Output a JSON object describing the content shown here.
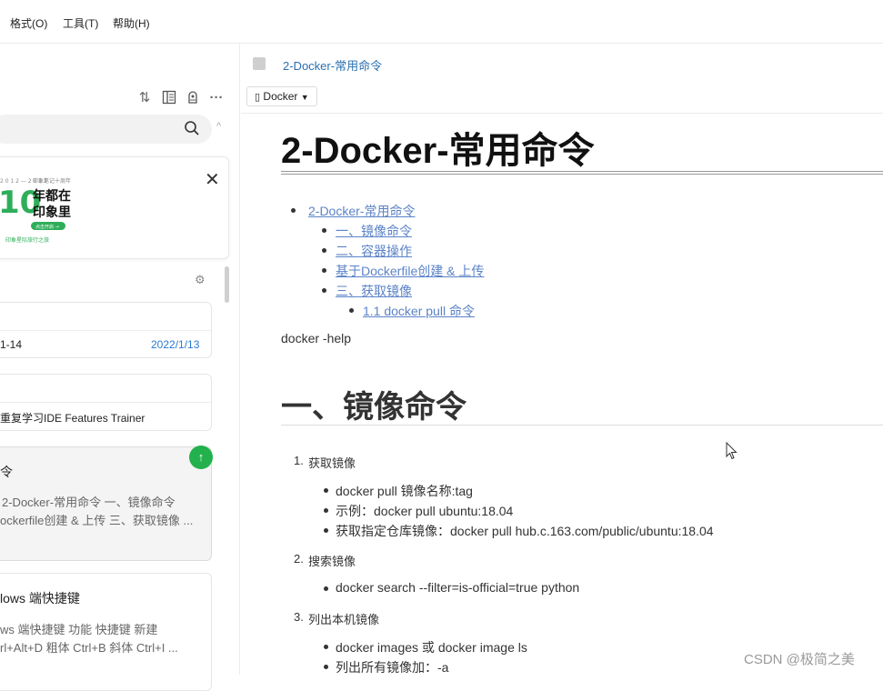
{
  "menu": {
    "format": "格式(O)",
    "tools": "工具(T)",
    "help": "帮助(H)"
  },
  "sidebar": {
    "cards": [
      {
        "date_partial": "1-14",
        "date": "2022/1/13"
      },
      {
        "snippet": "重复学习IDE Features Trainer"
      },
      {
        "title_partial": "令",
        "snippet_line1": "2-Docker-常用命令 一、镜像命令",
        "snippet_line2": "ockerfile创建 & 上传 三、获取镜像 ..."
      },
      {
        "title_partial": "lows 端快捷键",
        "snippet_line1": "ws 端快捷键 功能 快捷键 新建",
        "snippet_line2": "rl+Alt+D 粗体 Ctrl+B 斜体 Ctrl+I ..."
      }
    ],
    "promo_alt": "印象笔记十周年 年都在印象里",
    "sync_symbol": "↑"
  },
  "header": {
    "breadcrumb": "2-Docker-常用命令",
    "notebook": "Docker"
  },
  "doc": {
    "title": "2-Docker-常用命令",
    "toc": [
      {
        "label": "2-Docker-常用命令",
        "level": 1
      },
      {
        "label": "一、镜像命令",
        "level": 2
      },
      {
        "label": "二、容器操作",
        "level": 2
      },
      {
        "label": "基于Dockerfile创建 & 上传",
        "level": 2
      },
      {
        "label": "三、获取镜像",
        "level": 2
      },
      {
        "label": "1.1 docker pull 命令",
        "level": 3
      }
    ],
    "help_line": "docker -help",
    "section1_title": "一、镜像命令",
    "steps": [
      {
        "num": "1.",
        "label": "获取镜像",
        "items": [
          "docker pull 镜像名称:tag",
          "示例：docker pull ubuntu:18.04",
          "获取指定仓库镜像：docker pull hub.c.163.com/public/ubuntu:18.04"
        ]
      },
      {
        "num": "2.",
        "label": "搜索镜像",
        "items": [
          "docker search --filter=is-official=true python"
        ]
      },
      {
        "num": "3.",
        "label": "列出本机镜像",
        "items": [
          "docker images 或 docker image ls",
          "列出所有镜像加：-a"
        ]
      }
    ]
  },
  "watermark": "CSDN @极简之美"
}
